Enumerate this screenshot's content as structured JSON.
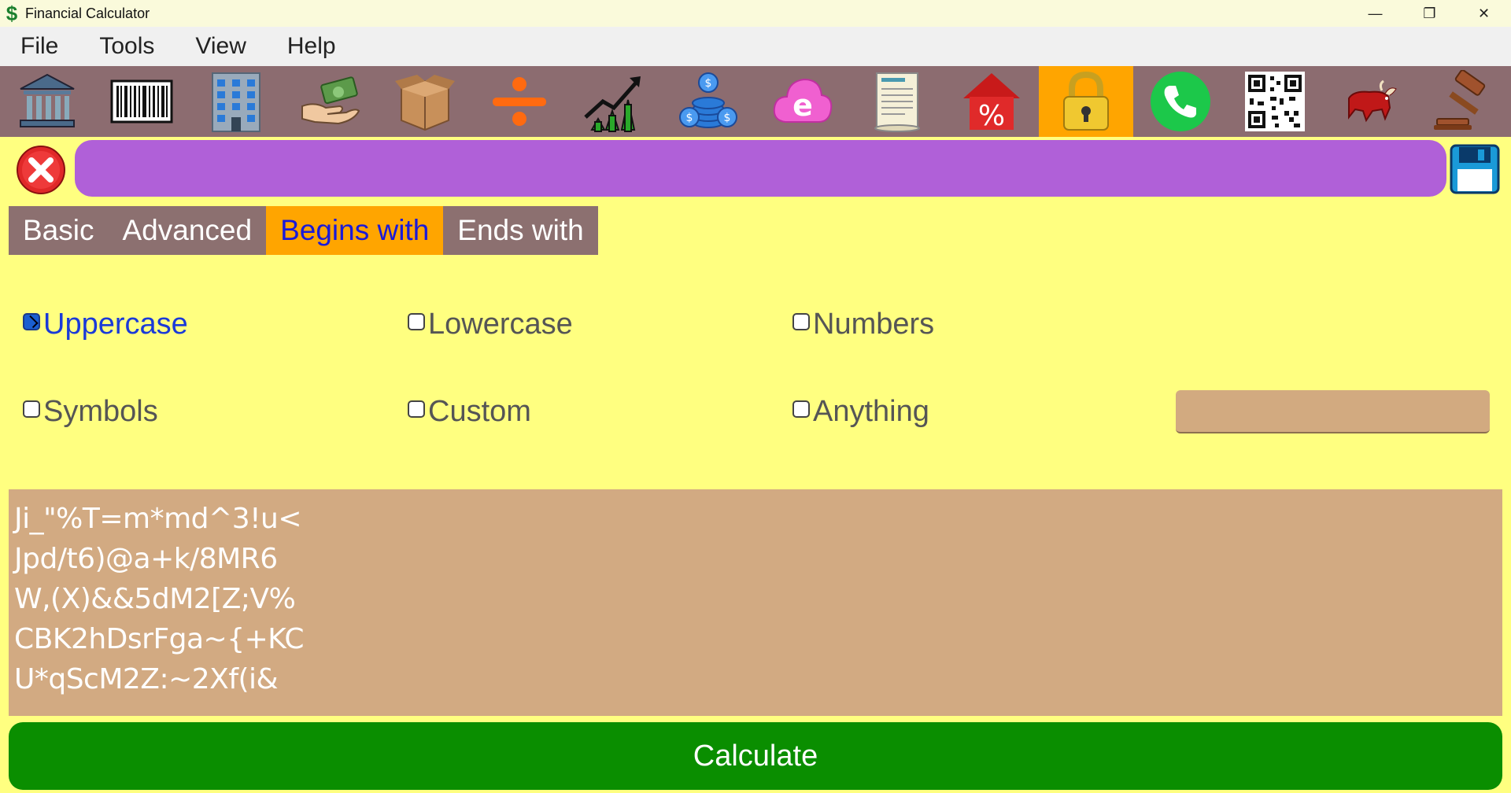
{
  "window": {
    "title": "Financial Calculator",
    "app_icon": "$",
    "controls": {
      "minimize": "—",
      "restore": "❐",
      "close": "✕"
    }
  },
  "menu": {
    "items": [
      {
        "label": "File"
      },
      {
        "label": "Tools"
      },
      {
        "label": "View"
      },
      {
        "label": "Help"
      }
    ]
  },
  "toolbar": {
    "tools": [
      {
        "icon": "bank-icon"
      },
      {
        "icon": "barcode-icon"
      },
      {
        "icon": "building-icon"
      },
      {
        "icon": "money-hand-icon"
      },
      {
        "icon": "box-icon"
      },
      {
        "icon": "divide-icon"
      },
      {
        "icon": "growth-chart-icon"
      },
      {
        "icon": "coins-icon"
      },
      {
        "icon": "internet-cloud-icon"
      },
      {
        "icon": "document-scroll-icon"
      },
      {
        "icon": "percent-house-icon"
      },
      {
        "icon": "padlock-icon",
        "active": true
      },
      {
        "icon": "phone-icon"
      },
      {
        "icon": "qr-code-icon"
      },
      {
        "icon": "bull-icon"
      },
      {
        "icon": "gavel-icon"
      }
    ]
  },
  "address": {
    "value": ""
  },
  "tabs": [
    {
      "label": "Basic"
    },
    {
      "label": "Advanced"
    },
    {
      "label": "Begins with",
      "active": true
    },
    {
      "label": "Ends with"
    }
  ],
  "options": {
    "uppercase": {
      "label": "Uppercase",
      "checked": true
    },
    "lowercase": {
      "label": "Lowercase",
      "checked": false
    },
    "numbers": {
      "label": "Numbers",
      "checked": false
    },
    "symbols": {
      "label": "Symbols",
      "checked": false
    },
    "custom": {
      "label": "Custom",
      "checked": false
    },
    "anything": {
      "label": "Anything",
      "checked": false
    }
  },
  "custom_input": {
    "value": ""
  },
  "output": {
    "lines": [
      "Ji_\"%T=m*md^3!u<",
      "Jpd/t6)@a+k/8MR6",
      "W,(X)&&5dM2[Z;V%",
      "CBK2hDsrFga~{+KC",
      "U*qScM2Z:~2Xf(i&"
    ]
  },
  "calculate": {
    "label": "Calculate"
  },
  "colors": {
    "background": "#ffff80",
    "toolbar": "#8c6c70",
    "active_tab": "#ffa500",
    "address_bar": "#b060d8",
    "output_bg": "#d2aa82",
    "calculate_bg": "#0a8e00"
  }
}
